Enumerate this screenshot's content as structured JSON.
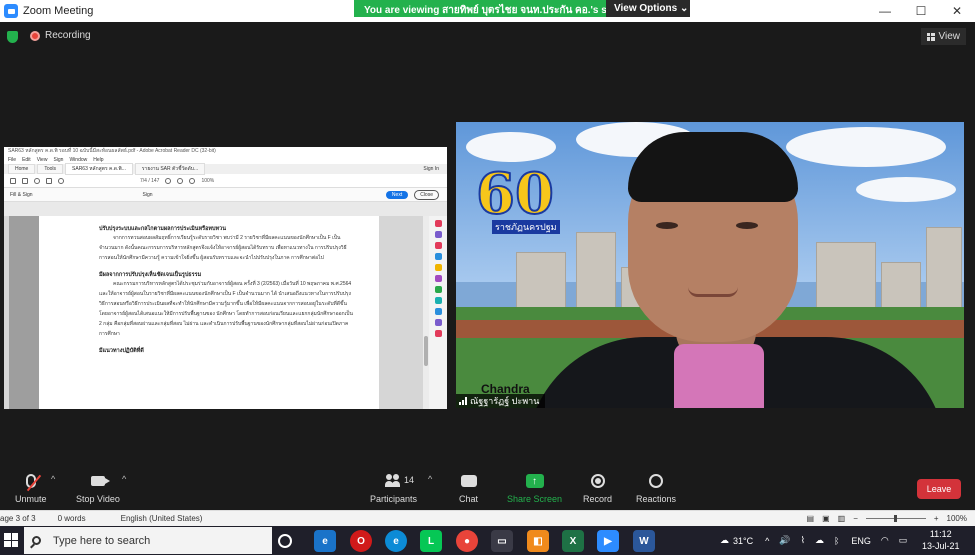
{
  "window": {
    "title": "Zoom Meeting",
    "minimize": "—",
    "maximize": "☐",
    "close": "✕"
  },
  "banner": {
    "viewing_text": "You are viewing สายทิพย์ บุตรไชย จนท.ประกัน คอ.'s screen",
    "view_options": "View Options ⌄"
  },
  "meeting_top": {
    "recording_label": "Recording",
    "view_label": "View"
  },
  "shared_screen": {
    "title_bar": "SAR63 หลักสูตร ค.ด.พิ รอบที่ 10 ฉบับนี้มีสะท้อนผลลัพธ์.pdf - Adobe Acrobat Reader DC (32-bit)",
    "menu": [
      "File",
      "Edit",
      "View",
      "Sign",
      "Window",
      "Help"
    ],
    "tabs": [
      "Home",
      "Tools",
      "SAR63 หลักสูตร ค.ด.พิ...",
      "รายงาน SAR ตัวชี้วัดดับ..."
    ],
    "sign_in": "Sign In",
    "page_indicator": "7/4 / 147",
    "zoom": "100%",
    "fill_sign_label": "Fill & Sign",
    "sign_label": "Sign",
    "next_label": "Next",
    "close_label": "Close",
    "heading1": "ปรับปรุงระบบและกลไกตามผลการประเมินหรือทบทวน",
    "para1": "จากการทวนสอบผลสัมฤทธิ์การเรียนรู้ระดับรายวิชา พบว่ามี 2 รายวิชาที่มีผลคะแนนของนักศึกษาเป็น F เป็นจำนวนมาก ดังนั้นคณะกรรมการบริหารหลักสูตรจึงแจ้งให้อาจารย์ผู้สอนได้รับทราบ เพื่อหาแนวทางใน การปรับปรุงวิธีการสอนให้นักศึกษามีความรู้ ความเข้าใจยิ่งขึ้น ผู้สอนรับทราบและจะนำไปปรับปรุงในภาค การศึกษาต่อไป",
    "heading2": "มีผลจากการปรับปรุงเห็นชัดเจนเป็นรูปธรรม",
    "para2": "คณะกรรมการบริหารหลักสูตรได้ประชุมร่วมกับอาจารย์ผู้สอน ครั้งที่ 3 (2/2563) เมื่อวันที่ 10 พฤษภาคม พ.ศ.2564 และให้อาจารย์ผู้สอนในรายวิชาที่มีผลคะแนนของนักศึกษาเป็น F เป็นจำนวนมาก ได้ นำเสนอถึงแนวทางในการปรับปรุงวิธีการสอนหรือวิธีการประเมินผลที่จะทำให้นักศึกษามีความรู้มากขึ้น เพื่อให้มีผลคะแนนจากการสอบอยู่ในระดับที่ดีขึ้น โดยอาจารย์ผู้สอนได้เสนอแนะให้มีการปรับพื้นฐานของ นักศึกษา โดยทำการสอบก่อนเรียนและแยกกลุ่มนักศึกษาออกเป็น 2 กลุ่ม คือกลุ่มที่สอบผ่านและกลุ่มที่สอบ ไม่ผ่าน และดำเนินการปรับพื้นฐานของนักศึกษากลุ่มที่สอบไม่ผ่านก่อนเปิดภาคการศึกษา",
    "heading3": "มีแนวทางปฏิบัติที่ดี"
  },
  "video": {
    "logo_number": "60",
    "logo_sub": "ราชภัฏนครปฐม",
    "background_name": "Chandra",
    "participant_name": "ณัฐฐารัฏฐ์ ปะพาน"
  },
  "controls": {
    "unmute": "Unmute",
    "stop_video": "Stop Video",
    "participants": "Participants",
    "participants_count": "14",
    "chat": "Chat",
    "share_screen": "Share Screen",
    "record": "Record",
    "reactions": "Reactions",
    "leave": "Leave"
  },
  "word_status": {
    "page": "age 3 of 3",
    "words": "0 words",
    "language": "English (United States)",
    "zoom": "100%",
    "minus": "−",
    "plus": "+"
  },
  "taskbar": {
    "search_placeholder": "Type here to search",
    "weather": "31°C",
    "lang": "ENG",
    "time": "11:12",
    "date": "13-Jul-21"
  },
  "colors": {
    "zoom_green": "#23b14d",
    "leave_red": "#d3333a",
    "record_red": "#e8443a",
    "zoom_blue": "#2d8cff"
  }
}
